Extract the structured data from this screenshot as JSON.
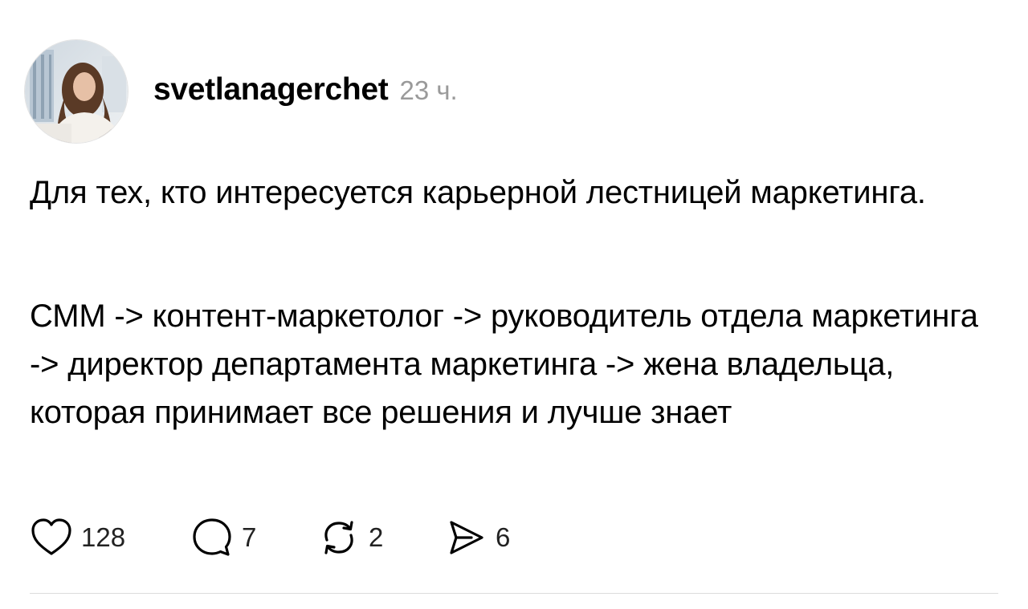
{
  "post": {
    "author": {
      "username": "svetlanagerchet",
      "time": "23 ч."
    },
    "paragraphs": [
      "Для тех, кто интересуется карьерной лестницей маркетинга.",
      "СММ -> контент-маркетолог -> руководитель отдела маркетинга -> директор департамента маркетинга -> жена владельца, которая принимает все решения и лучше знает"
    ],
    "actions": {
      "likes": "128",
      "comments": "7",
      "reposts": "2",
      "shares": "6"
    }
  },
  "icons": {
    "like": "heart-icon",
    "comment": "comment-bubble-icon",
    "repost": "repost-icon",
    "share": "send-icon"
  },
  "colors": {
    "text": "#000000",
    "muted": "#9a9a9a",
    "divider": "#dcdcdc",
    "background": "#ffffff"
  }
}
